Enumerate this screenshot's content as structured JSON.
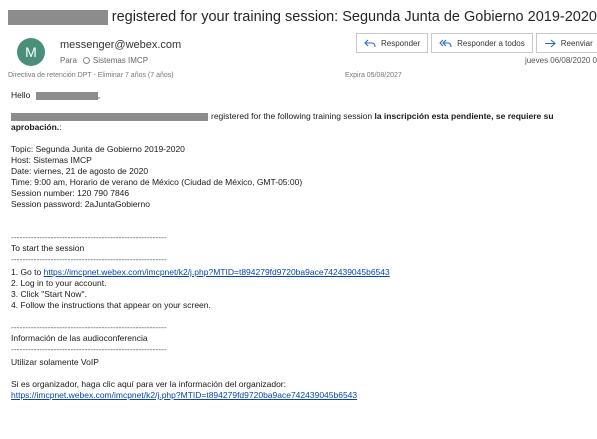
{
  "header": {
    "subject": "registered for your training session: Segunda Junta de Gobierno 2019-2020",
    "avatar_initial": "M",
    "sender": "messenger@webex.com",
    "to_label": "Para",
    "to_name": "Sistemas IMCP",
    "retention": "Directiva de retención  DPT - Eliminar 7 años (7 años)",
    "expires": "Expira  05/08/2027",
    "date": "jueves 06/08/2020 0",
    "reply_label": "Responder",
    "reply_all_label": "Responder a todos",
    "forward_label": "Reenviar"
  },
  "body": {
    "greeting": "Hello",
    "greeting_suffix": ",",
    "reg_text": "registered for the following training session ",
    "reg_bold": "la inscripción esta pendiente, se requiere su",
    "reg_bold2": "aprobación.",
    "reg_end": ":",
    "topic": "Topic: Segunda Junta de Gobierno 2019-2020",
    "host": "Host: Sistemas IMCP",
    "date": "Date: viernes, 21 de agosto de 2020",
    "time": "Time: 9:00 am, Horario de verano de México (Ciudad de México, GMT-05:00)",
    "session_number": "Session number: 120 790 7846",
    "session_password": "Session password: 2aJuntaGobierno",
    "dashes": "-------------------------------------------------------",
    "start_heading": "To start the session",
    "step1_prefix": "1. Go to ",
    "step1_link": "https://imcpnet.webex.com/imcpnet/k2/j.php?MTID=t894279fd9720ba9ace742439045b6543",
    "step2": "2. Log in to your account.",
    "step3": "3. Click \"Start Now\".",
    "step4": "4. Follow the instructions that appear on your screen.",
    "audio_heading": "Información de las audioconferencia",
    "voip": "Utilizar solamente VoIP",
    "organizer_text": "Si es organizador, haga clic aquí para ver la información del organizador:",
    "organizer_link": "https://imcpnet.webex.com/imcpnet/k2/j.php?MTID=t894279fd9720ba9ace742439045b6543"
  },
  "colors": {
    "avatar": "#4a8f7a",
    "link": "#0645ad",
    "action_icon": "#2b6cc4",
    "redaction": "#8c8c8c"
  }
}
